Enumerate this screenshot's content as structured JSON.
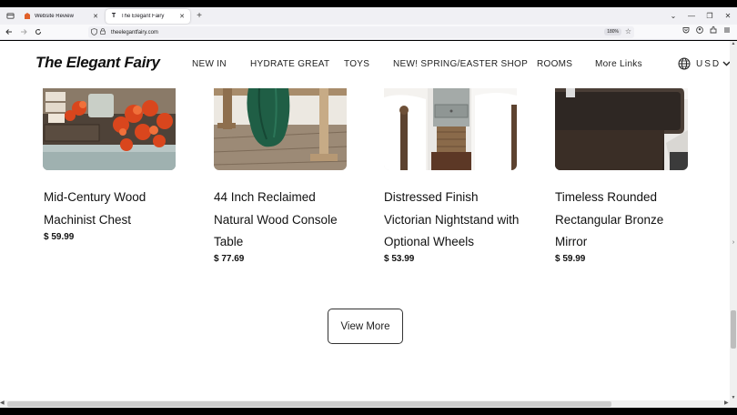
{
  "browser": {
    "tabs": [
      {
        "title": "Website Review",
        "active": false,
        "favicon": "review-favicon-icon"
      },
      {
        "title": "The Elegant Fairy",
        "active": true,
        "favicon": "T"
      }
    ],
    "new_tab_symbol": "+",
    "list_tabs_symbol": "⌄",
    "window_controls": {
      "minimize": "—",
      "restore": "❐",
      "close": "✕"
    },
    "url": "theelegantfairy.com",
    "zoom": "180%"
  },
  "site": {
    "logo": "The Elegant Fairy",
    "menu": [
      "NEW IN",
      "HYDRATE GREAT",
      "TOYS",
      "NEW! SPRING/EASTER SHOP",
      "ROOMS",
      "More Links"
    ],
    "currency": "USD"
  },
  "products": [
    {
      "name": "Mid-Century Wood Machinist Chest",
      "price": "$ 59.99"
    },
    {
      "name": "44 Inch Reclaimed Natural Wood Console Table",
      "price": "$ 77.69"
    },
    {
      "name": "Distressed Finish Victorian Nightstand with Optional Wheels",
      "price": "$ 53.99"
    },
    {
      "name": "Timeless Rounded Rectangular Bronze Mirror",
      "price": "$ 59.99"
    }
  ],
  "view_more_label": "View More",
  "colors": {
    "accent": "#e0602a",
    "text": "#111111",
    "chrome": "#f0f0f4"
  }
}
